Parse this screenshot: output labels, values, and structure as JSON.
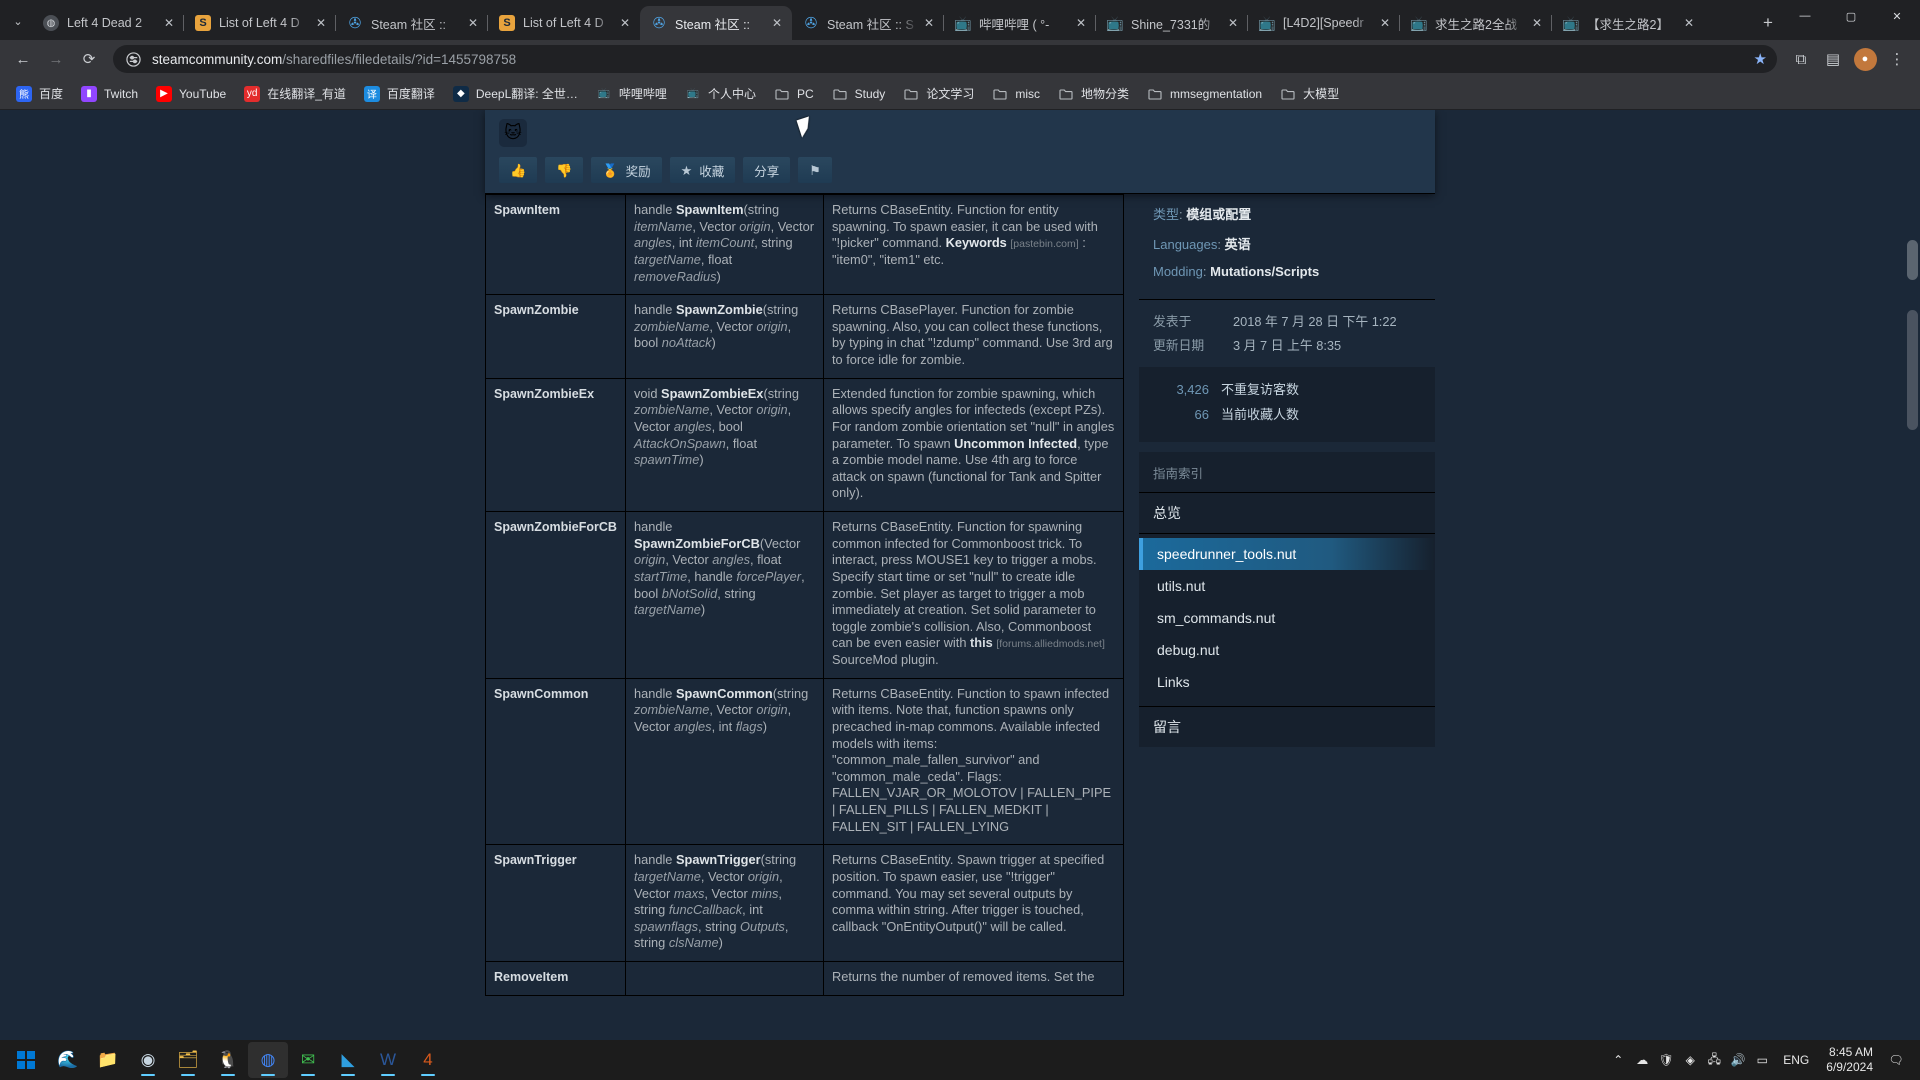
{
  "browser": {
    "tabs": [
      {
        "title": "Left 4 Dead 2",
        "favicon": "l4d-globe-icon",
        "type": "l4d",
        "active": false
      },
      {
        "title": "List of Left 4 D",
        "favicon": "steam-orange-icon",
        "type": "steam-orange",
        "active": false
      },
      {
        "title": "Steam 社区 ::",
        "favicon": "steam-blue-icon",
        "type": "steam-blue",
        "active": false
      },
      {
        "title": "List of Left 4 D",
        "favicon": "steam-orange-icon",
        "type": "steam-orange",
        "active": false
      },
      {
        "title": "Steam 社区 ::",
        "favicon": "steam-blue-icon",
        "type": "steam-blue",
        "active": true
      },
      {
        "title": "Steam 社区 :: S",
        "favicon": "steam-blue-icon",
        "type": "steam-blue",
        "active": false
      },
      {
        "title": "哔哩哔哩 ( °-",
        "favicon": "bilibili-icon",
        "type": "bili",
        "active": false
      },
      {
        "title": "Shine_7331的",
        "favicon": "bilibili-icon",
        "type": "bili",
        "active": false
      },
      {
        "title": "[L4D2][Speedr",
        "favicon": "bilibili-icon",
        "type": "bili",
        "active": false
      },
      {
        "title": "求生之路2全战",
        "favicon": "bilibili-icon",
        "type": "bili",
        "active": false
      },
      {
        "title": "【求生之路2】",
        "favicon": "bilibili-icon",
        "type": "bili",
        "active": false
      }
    ],
    "tab_close_label": "✕",
    "new_tab_label": "+",
    "tab_list_label": "⌄",
    "window_controls": {
      "minimize": "—",
      "maximize": "▢",
      "close": "✕"
    },
    "nav": {
      "back": "←",
      "forward": "→",
      "reload": "⟳"
    },
    "omnibox": {
      "site_settings_icon": "tune-icon",
      "url_host": "steamcommunity.com",
      "url_path": "/sharedfiles/filedetails/?id=1455798758"
    },
    "toolbar_right": {
      "bookmark_star": "★",
      "extensions": "⧉",
      "media": "▤",
      "profile": "●",
      "menu": "⋮"
    },
    "bookmarks": [
      {
        "label": "百度",
        "icon": "baidu-icon",
        "color": "#2d65f2",
        "glyph": "熊"
      },
      {
        "label": "Twitch",
        "icon": "twitch-icon",
        "color": "#9146ff",
        "glyph": "▮"
      },
      {
        "label": "YouTube",
        "icon": "youtube-icon",
        "color": "#ff0000",
        "glyph": "▶"
      },
      {
        "label": "在线翻译_有道",
        "icon": "youdao-icon",
        "color": "#e32d2d",
        "glyph": "yd"
      },
      {
        "label": "百度翻译",
        "icon": "fanyi-icon",
        "color": "#1d8ce0",
        "glyph": "译"
      },
      {
        "label": "DeepL翻译: 全世…",
        "icon": "deepl-icon",
        "color": "#0f2b46",
        "glyph": "◆"
      },
      {
        "label": "哔哩哔哩",
        "icon": "bilibili-icon",
        "color": "transparent",
        "glyph": "📺"
      },
      {
        "label": "个人中心",
        "icon": "bilibili-icon",
        "color": "transparent",
        "glyph": "📺"
      },
      {
        "label": "PC",
        "icon": "folder-icon",
        "color": "transparent",
        "glyph": "▭"
      },
      {
        "label": "Study",
        "icon": "folder-icon",
        "color": "transparent",
        "glyph": "▭"
      },
      {
        "label": "论文学习",
        "icon": "folder-icon",
        "color": "transparent",
        "glyph": "▭"
      },
      {
        "label": "misc",
        "icon": "folder-icon",
        "color": "transparent",
        "glyph": "▭"
      },
      {
        "label": "地物分类",
        "icon": "folder-icon",
        "color": "transparent",
        "glyph": "▭"
      },
      {
        "label": "mmsegmentation",
        "icon": "folder-icon",
        "color": "transparent",
        "glyph": "▭"
      },
      {
        "label": "大模型",
        "icon": "folder-icon",
        "color": "transparent",
        "glyph": "▭"
      }
    ]
  },
  "page": {
    "actions": [
      {
        "label": "",
        "icon": "thumbs-up-icon",
        "glyph": "👍"
      },
      {
        "label": "",
        "icon": "thumbs-down-icon",
        "glyph": "👎"
      },
      {
        "label": "奖励",
        "icon": "award-icon",
        "glyph": "🏅"
      },
      {
        "label": "收藏",
        "icon": "star-icon",
        "glyph": "★"
      },
      {
        "label": "分享",
        "icon": "share-icon",
        "glyph": ""
      },
      {
        "label": "",
        "icon": "flag-icon",
        "glyph": "⚑"
      }
    ],
    "functions": [
      {
        "name": "SpawnItem",
        "sig_html": "handle <b>SpawnItem</b>(string <i>itemName</i>, Vector <i>origin</i>, Vector <i>angles</i>, int <i>itemCount</i>, string <i>targetName</i>, float <i>removeRadius</i>)",
        "desc_html": "Returns CBaseEntity. Function for entity spawning. To spawn easier, it can be used with \"!picker\" command. <b>Keywords</b> <span class=\"ext\">[pastebin.com]</span> : \"item0\", \"item1\" etc."
      },
      {
        "name": "SpawnZombie",
        "sig_html": "handle <b>SpawnZombie</b>(string <i>zombieName</i>, Vector <i>origin</i>, bool <i>noAttack</i>)",
        "desc_html": "Returns CBasePlayer. Function for zombie spawning. Also, you can collect these functions, by typing in chat \"!zdump\" command. Use 3rd arg to force idle for zombie."
      },
      {
        "name": "SpawnZombieEx",
        "sig_html": "void <b>SpawnZombieEx</b>(string <i>zombieName</i>, Vector <i>origin</i>, Vector <i>angles</i>, bool <i>AttackOnSpawn</i>, float <i>spawnTime</i>)",
        "desc_html": "Extended function for zombie spawning, which allows specify angles for infecteds (except PZs). For random zombie orientation set \"null\" in angles parameter. To spawn <b>Uncommon Infected</b>, type a zombie model name. Use 4th arg to force attack on spawn (functional for Tank and Spitter only)."
      },
      {
        "name": "SpawnZombieForCB",
        "sig_html": "handle <b>SpawnZombieForCB</b>(Vector <i>origin</i>, Vector <i>angles</i>, float <i>startTime</i>, handle <i>forcePlayer</i>, bool <i>bNotSolid</i>, string <i>targetName</i>)",
        "desc_html": "Returns CBaseEntity. Function for spawning common infected for Commonboost trick. To interact, press MOUSE1 key to trigger a mobs. Specify start time or set \"null\" to create idle zombie. Set player as target to trigger a mob immediately at creation. Set solid parameter to toggle zombie's collision. Also, Commonboost can be even easier with <a class=\"lnk\">this</a> <span class=\"ext\">[forums.alliedmods.net]</span> SourceMod plugin."
      },
      {
        "name": "SpawnCommon",
        "sig_html": "handle <b>SpawnCommon</b>(string <i>zombieName</i>, Vector <i>origin</i>, Vector <i>angles</i>, int <i>flags</i>)",
        "desc_html": "Returns CBaseEntity. Function to spawn infected with items. Note that, function spawns only precached in-map commons. Available infected models with items: \"common_male_fallen_survivor\" and \"common_male_ceda\". Flags: FALLEN_VJAR_OR_MOLOTOV | FALLEN_PIPE | FALLEN_PILLS | FALLEN_MEDKIT | FALLEN_SIT | FALLEN_LYING"
      },
      {
        "name": "SpawnTrigger",
        "sig_html": "handle <b>SpawnTrigger</b>(string <i>targetName</i>, Vector <i>origin</i>, Vector <i>maxs</i>, Vector <i>mins</i>, string <i>funcCallback</i>, int <i>spawnflags</i>, string <i>Outputs</i>, string <i>clsName</i>)",
        "desc_html": "Returns CBaseEntity. Spawn trigger at specified position. To spawn easier, use \"!trigger\" command. You may set several outputs by comma within string. After trigger is touched, callback \"OnEntityOutput()\" will be called."
      },
      {
        "name": "RemoveItem",
        "sig_html": "",
        "desc_html": "Returns the number of removed items. Set the"
      }
    ],
    "details": {
      "type_label": "类型",
      "type_value": "模组或配置",
      "languages_label": "Languages",
      "languages_value": "英语",
      "modding_label": "Modding",
      "modding_value": "Mutations/Scripts",
      "posted_label": "发表于",
      "posted_value": "2018 年 7 月 28 日 下午 1:22",
      "updated_label": "更新日期",
      "updated_value": "3 月 7 日 上午 8:35"
    },
    "stats": [
      {
        "number": "3,426",
        "label": "不重复访客数"
      },
      {
        "number": "66",
        "label": "当前收藏人数"
      }
    ],
    "index": {
      "title": "指南索引",
      "overview": "总览",
      "items": [
        {
          "label": "speedrunner_tools.nut",
          "active": true
        },
        {
          "label": "utils.nut",
          "active": false
        },
        {
          "label": "sm_commands.nut",
          "active": false
        },
        {
          "label": "debug.nut",
          "active": false
        },
        {
          "label": "Links",
          "active": false
        }
      ],
      "comments": "留言"
    }
  },
  "taskbar": {
    "start": "⊞",
    "apps": [
      {
        "name": "edge-icon",
        "glyph": "🌊",
        "color": "#3fa9f5",
        "running": false,
        "active": false
      },
      {
        "name": "explorer-icon",
        "glyph": "📁",
        "color": "#ffc95c",
        "running": false,
        "active": false
      },
      {
        "name": "steam-icon",
        "glyph": "◉",
        "color": "#c7d5e0",
        "running": true,
        "active": false
      },
      {
        "name": "files-icon",
        "glyph": "🗂",
        "color": "#f5c04a",
        "running": true,
        "active": false
      },
      {
        "name": "qq-icon",
        "glyph": "🐧",
        "color": "#e8a33d",
        "running": true,
        "active": false
      },
      {
        "name": "chrome-icon",
        "glyph": "◍",
        "color": "#4285f4",
        "running": true,
        "active": true
      },
      {
        "name": "wechat-icon",
        "glyph": "✉",
        "color": "#3fbd4f",
        "running": true,
        "active": false
      },
      {
        "name": "vscode-icon",
        "glyph": "◣",
        "color": "#2f9fe0",
        "running": true,
        "active": false
      },
      {
        "name": "word-icon",
        "glyph": "W",
        "color": "#2b579a",
        "running": true,
        "active": false
      },
      {
        "name": "l4d2-icon",
        "glyph": "4",
        "color": "#d85a1c",
        "running": true,
        "active": false
      }
    ],
    "tray": [
      {
        "name": "chevron-up-icon",
        "glyph": "⌃"
      },
      {
        "name": "cloud-icon",
        "glyph": "☁"
      },
      {
        "name": "shield-icon",
        "glyph": "🛡"
      },
      {
        "name": "app-tray-icon",
        "glyph": "◈"
      },
      {
        "name": "network-icon",
        "glyph": "🖧"
      },
      {
        "name": "volume-icon",
        "glyph": "🔊"
      },
      {
        "name": "battery-icon",
        "glyph": "▭"
      }
    ],
    "language": "ENG",
    "time": "8:45 AM",
    "date": "6/9/2024",
    "notification": "🗨"
  }
}
